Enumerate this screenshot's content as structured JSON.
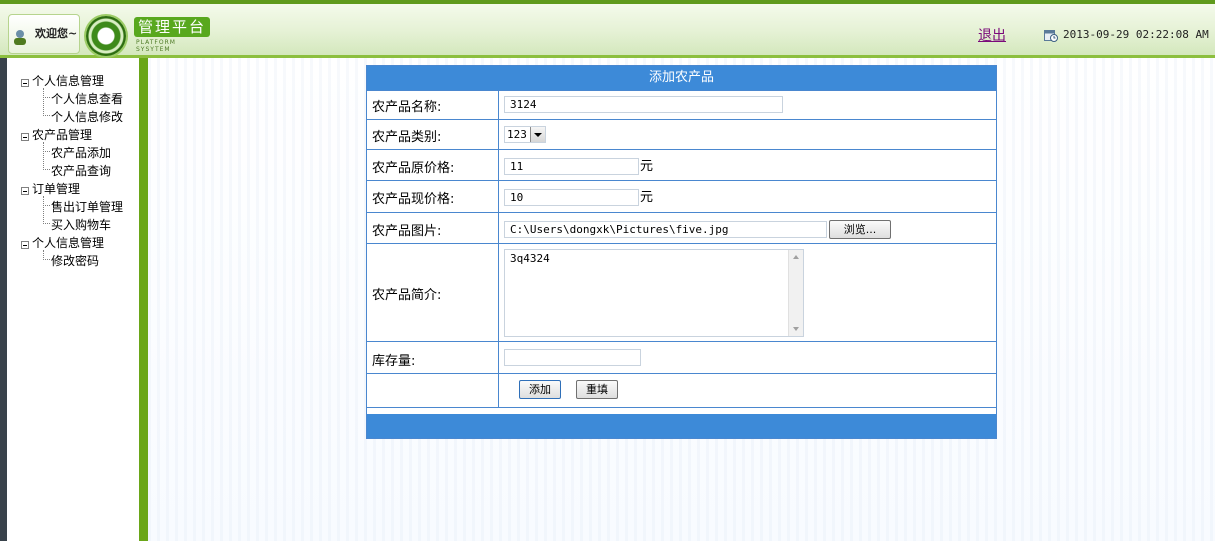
{
  "header": {
    "welcome": "欢迎您~",
    "logo_title": "管理平台",
    "logo_subtitle": "PLATFORM SYSYTEM",
    "logout": "退出",
    "datetime": "2013-09-29 02:22:08 AM"
  },
  "sidebar": {
    "groups": [
      {
        "label": "个人信息管理",
        "items": [
          "个人信息查看",
          "个人信息修改"
        ]
      },
      {
        "label": "农产品管理",
        "items": [
          "农产品添加",
          "农产品查询"
        ]
      },
      {
        "label": "订单管理",
        "items": [
          "售出订单管理",
          "买入购物车"
        ]
      },
      {
        "label": "个人信息管理",
        "items": [
          "修改密码"
        ]
      }
    ]
  },
  "form": {
    "title": "添加农产品",
    "name_label": "农产品名称:",
    "name_value": "3124",
    "category_label": "农产品类别:",
    "category_value": "123",
    "orig_price_label": "农产品原价格:",
    "orig_price_value": "11",
    "cur_price_label": "农产品现价格:",
    "cur_price_value": "10",
    "currency_unit": "元",
    "image_label": "农产品图片:",
    "image_value": "C:\\Users\\dongxk\\Pictures\\five.jpg",
    "browse_button": "浏览...",
    "desc_label": "农产品简介:",
    "desc_value": "3q4324",
    "stock_label": "库存量:",
    "stock_value": "",
    "submit_button": "添加",
    "reset_button": "重填"
  },
  "colors": {
    "accent_green": "#6aa618",
    "panel_blue": "#3d8ad8"
  }
}
